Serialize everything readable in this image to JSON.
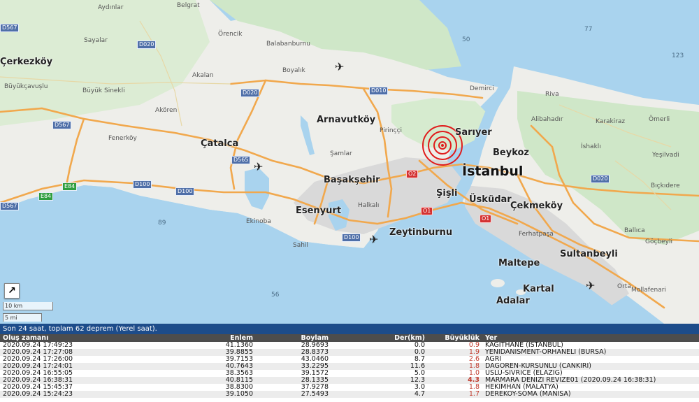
{
  "map": {
    "scale": {
      "km": "10 km",
      "mi": "5 mi"
    },
    "expand_icon": "↗",
    "places_big": [
      "Çerkezköy",
      "Arnavutköy",
      "Sarıyer",
      "Çatalca",
      "Beykoz",
      "Başakşehir",
      "Şişli",
      "Esenyurt",
      "Üsküdar",
      "Çekmeköy",
      "Zeytinburnu",
      "Maltepe",
      "Sultanbeyli",
      "Kartal",
      "Adalar"
    ],
    "place_istanbul": "İstanbul",
    "places_small": [
      "Aydınlar",
      "Belgrat",
      "Sayalar",
      "Örencik",
      "Balabanburnu",
      "Büyükçavuşlu",
      "Büyük Sinekli",
      "Akalan",
      "Boyalık",
      "Akören",
      "Fenerköy",
      "Demirci",
      "Riva",
      "Alibahadır",
      "Karakiraz",
      "Ömerli",
      "Pirinççi",
      "Şamlar",
      "İshaklı",
      "Yeşilvadi",
      "Halkalı",
      "Bıçkıdere",
      "Ekinoba",
      "Sahil",
      "Ferhatpaşa",
      "Ballıca",
      "Göçbeyli",
      "Orta",
      "Mollafenari"
    ],
    "sea_numbers": [
      "77",
      "50",
      "123",
      "89",
      "56"
    ],
    "shields_blue": [
      "D567",
      "D020",
      "D020",
      "D567",
      "D565",
      "D100",
      "D100",
      "D100",
      "D020",
      "D567"
    ],
    "shields_green": [
      "E84",
      "E84"
    ],
    "shields_red": [
      "O2",
      "O1",
      "O1"
    ]
  },
  "panel": {
    "title": "Son 24 saat, toplam 62 deprem (Yerel saat).",
    "columns": [
      "Oluş zamanı",
      "Enlem",
      "Boylam",
      "Der(km)",
      "Büyüklük",
      "Yer"
    ],
    "rows": [
      [
        "2020.09.24 17:49:23",
        "41.1360",
        "28.9693",
        "0.0",
        "0.9",
        "KAGITHANE (ISTANBUL)"
      ],
      [
        "2020.09.24 17:27:08",
        "39.8855",
        "28.8373",
        "0.0",
        "1.9",
        "YENIDANISMENT-ORHANELI (BURSA)"
      ],
      [
        "2020.09.24 17:26:00",
        "39.7153",
        "43.0460",
        "8.7",
        "2.6",
        "AGRI"
      ],
      [
        "2020.09.24 17:24:01",
        "40.7643",
        "33.2295",
        "11.6",
        "1.8",
        "DAGOREN-KURSUNLU (CANKIRI)"
      ],
      [
        "2020.09.24 16:55:05",
        "38.3563",
        "39.1572",
        "5.0",
        "1.0",
        "USLU-SIVRICE (ELAZIG)"
      ],
      [
        "2020.09.24 16:38:31",
        "40.8115",
        "28.1335",
        "12.3",
        "4.3",
        "MARMARA DENIZI REVIZE01 (2020.09.24 16:38:31)"
      ],
      [
        "2020.09.24 15:45:37",
        "38.8300",
        "37.9278",
        "3.0",
        "1.8",
        "HEKIMHAN (MALATYA)"
      ],
      [
        "2020.09.24 15:24:23",
        "39.1050",
        "27.5493",
        "4.7",
        "1.7",
        "DEREKOY-SOMA (MANISA)"
      ]
    ]
  }
}
